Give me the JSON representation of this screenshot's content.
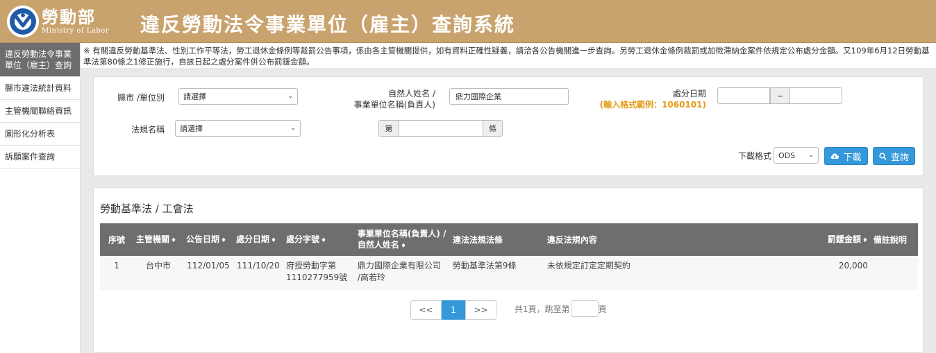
{
  "header": {
    "logo_cn": "勞動部",
    "logo_en": "Ministry of Labor",
    "title": "違反勞動法令事業單位（雇主）查詢系統"
  },
  "sidebar": {
    "items": [
      {
        "label": "違反勞動法令事業單位（雇主）查詢",
        "active": true
      },
      {
        "label": "縣市違法統計資料"
      },
      {
        "label": "主管機關聯絡資訊"
      },
      {
        "label": "圖形化分析表"
      },
      {
        "label": "訴願案件查詢"
      }
    ]
  },
  "notice": "※ 有關違反勞動基準法、性別工作平等法，勞工退休金條例等裁罰公告事項，係由各主管機關提供，如有資料正確性疑義，請洽各公告機關進一步查詢。另勞工退休金條例裁罰或加徵滯納金案件依規定公布處分金額。又109年6月12日勞動基準法第80條之1修正施行，自該日起之處分案件併公布罰鍰金額。",
  "search": {
    "county_label": "縣市 /單位別",
    "county_value": "請選擇",
    "name_label_1": "自然人姓名 /",
    "name_label_2": "事業單位名稱(負責人)",
    "name_value": "鼎力國際企業",
    "date_label": "處分日期",
    "date_hint": "(輸入格式範例：1060101)",
    "date_sep": "~",
    "law_label": "法規名稱",
    "law_value": "請選擇",
    "article_prefix": "第",
    "article_suffix": "條",
    "format_label": "下載格式",
    "format_value": "ODS",
    "download_label": "下載",
    "query_label": "查詢"
  },
  "results": {
    "section_title": "勞動基準法 / 工會法",
    "columns": {
      "seq": "序號",
      "authority": "主管機關",
      "announce_date": "公告日期",
      "penalty_date": "處分日期",
      "doc_no": "處分字號",
      "employer_1": "事業單位名稱(負責人) /",
      "employer_2": "自然人姓名",
      "law": "違法法規法條",
      "content": "違反法規內容",
      "fine": "罰鍰金額",
      "remark": "備註說明"
    },
    "rows": [
      {
        "seq": "1",
        "authority": "台中市",
        "announce_date": "112/01/05",
        "penalty_date": "111/10/20",
        "doc_no_1": "府授勞動字第",
        "doc_no_2": "1110277959號",
        "employer_1": "鼎力國際企業有限公司",
        "employer_2": "/高若玲",
        "law": "勞動基準法第9條",
        "content": "未依規定訂定定期契約",
        "fine": "20,000",
        "remark": ""
      }
    ]
  },
  "pager": {
    "prev": "<<",
    "current": "1",
    "next": ">>",
    "info_prefix": "共1頁，跳至第",
    "info_suffix": "頁"
  },
  "colors": {
    "header_bg": "#c9a36e",
    "accent": "#3498db",
    "hint": "#e69a15",
    "table_header": "#6e6e6e"
  }
}
